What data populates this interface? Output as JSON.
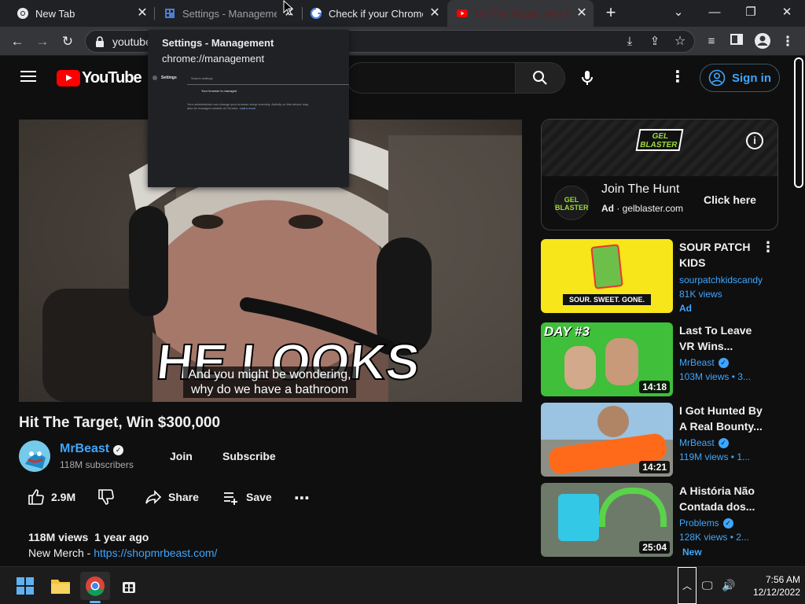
{
  "browser": {
    "tabs": [
      {
        "title": "New Tab",
        "icon": "chrome-icon",
        "active": false
      },
      {
        "title": "Settings - Management",
        "icon": "settings-building-icon",
        "active": false
      },
      {
        "title": "Check if your Chrome b",
        "icon": "google-icon",
        "active": false
      },
      {
        "title": "Hit The Target, Win $30",
        "icon": "youtube-icon",
        "active": true
      }
    ],
    "new_tab": "+",
    "url": "youtube"
  },
  "hover_card": {
    "title": "Settings - Management",
    "url": "chrome://management",
    "preview": {
      "sidebar_label": "Settings",
      "search_placeholder": "Search settings",
      "managed_text": "Your browser is managed",
      "body_text": "Your administrator can change your browser setup remotely. Activity on this device may also be managed outside of Chrome.",
      "learn_more": "Learn more"
    }
  },
  "youtube": {
    "logo_text": "YouTube",
    "signin": "Sign in"
  },
  "video": {
    "caption_line1": "And you might be wondering,",
    "caption_line2": "why do we have a bathroom",
    "overlay_text": "HE LOOKS",
    "title": "Hit The Target, Win $300,000",
    "channel": "MrBeast",
    "subscribers": "118M subscribers",
    "join": "Join",
    "subscribe": "Subscribe",
    "likes": "2.9M",
    "share": "Share",
    "save": "Save",
    "views": "118M views",
    "age": "1 year ago",
    "desc_prefix": "New Merch - ",
    "desc_link": "https://shopmrbeast.com/"
  },
  "ad": {
    "brand": "GEL BLASTER",
    "title": "Join The Hunt",
    "label": "Ad",
    "domain": "gelblaster.com",
    "cta": "Click here"
  },
  "recommendations": [
    {
      "title_l1": "SOUR PATCH",
      "title_l2": "KIDS",
      "channel": "sourpatchkidscandy",
      "meta": "81K views",
      "extra": "Ad",
      "duration": "",
      "thumb_text": "SOUR. SWEET. GONE."
    },
    {
      "title_l1": "Last To Leave",
      "title_l2": "VR Wins...",
      "channel": "MrBeast",
      "meta": "103M views  • 3...",
      "extra": "",
      "duration": "14:18",
      "thumb_text": "DAY #3"
    },
    {
      "title_l1": "I Got Hunted By",
      "title_l2": "A Real Bounty...",
      "channel": "MrBeast",
      "meta": "119M views  • 1...",
      "extra": "",
      "duration": "14:21",
      "thumb_text": ""
    },
    {
      "title_l1": "A História Não",
      "title_l2": "Contada dos...",
      "channel": "Problems",
      "meta": "128K views  • 2...",
      "extra": "New",
      "duration": "25:04",
      "thumb_text": ""
    }
  ],
  "taskbar": {
    "time": "7:56 AM",
    "date": "12/12/2022"
  }
}
